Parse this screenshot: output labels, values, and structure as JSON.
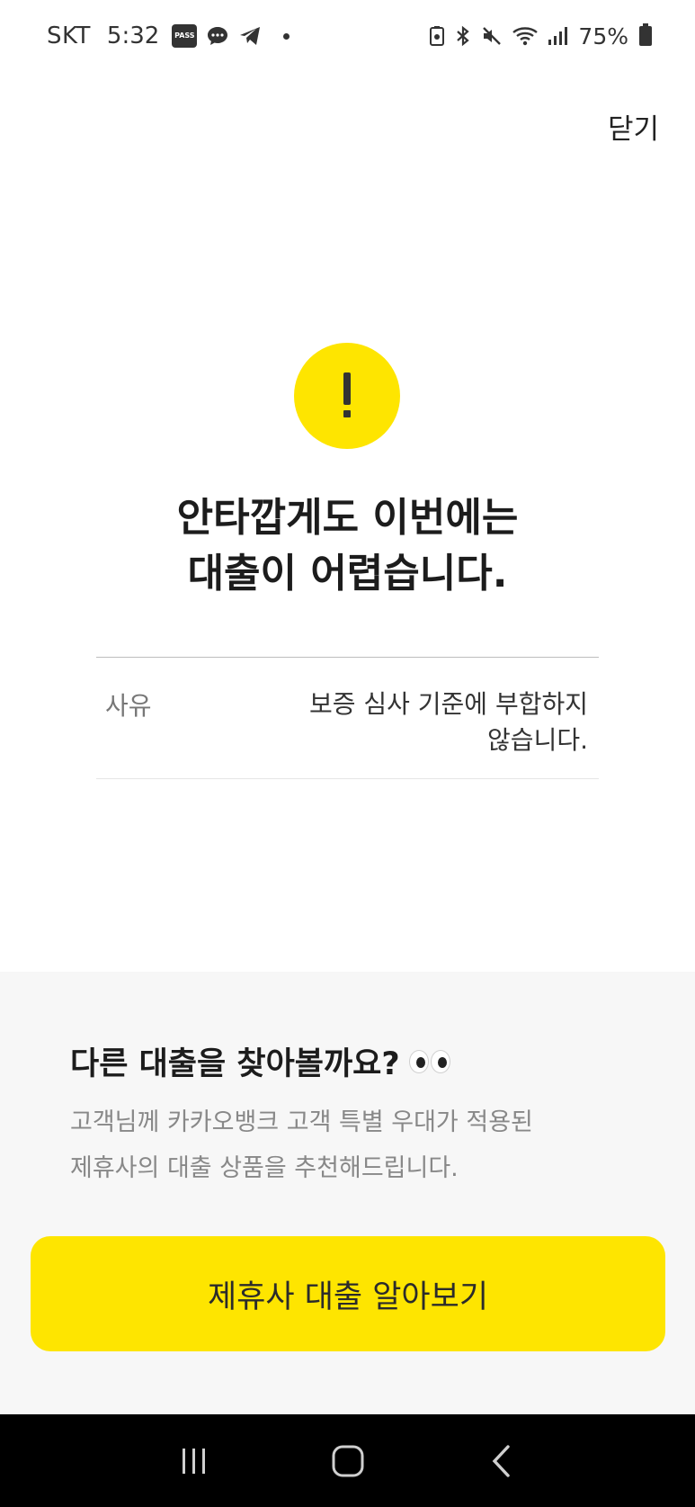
{
  "status_bar": {
    "carrier": "SKT",
    "time": "5:32",
    "pass_badge": "PASS",
    "battery": "75%",
    "icons": [
      "pass-icon",
      "chat-bubble-icon",
      "telegram-icon",
      "notification-dot",
      "battery-saver-icon",
      "bluetooth-icon",
      "mute-icon",
      "wifi-icon",
      "signal-icon",
      "battery-icon"
    ]
  },
  "header": {
    "close_label": "닫기"
  },
  "result": {
    "icon": "exclamation-icon",
    "icon_color": "#fee500",
    "title_line1": "안타깝게도 이번에는",
    "title_line2": "대출이 어렵습니다."
  },
  "reason": {
    "label": "사유",
    "value_line1": "보증 심사 기준에 부합하지",
    "value_line2": "않습니다."
  },
  "promo": {
    "title": "다른 대출을 찾아볼까요?",
    "emoji_icon": "eyes-icon",
    "desc_line1": "고객님께 카카오뱅크 고객 특별 우대가 적용된",
    "desc_line2": "제휴사의 대출 상품을 추천해드립니다.",
    "button_label": "제휴사 대출 알아보기",
    "accent_color": "#fee500"
  },
  "nav_bar": {
    "buttons": [
      "recent-apps-icon",
      "home-icon",
      "back-icon"
    ]
  }
}
